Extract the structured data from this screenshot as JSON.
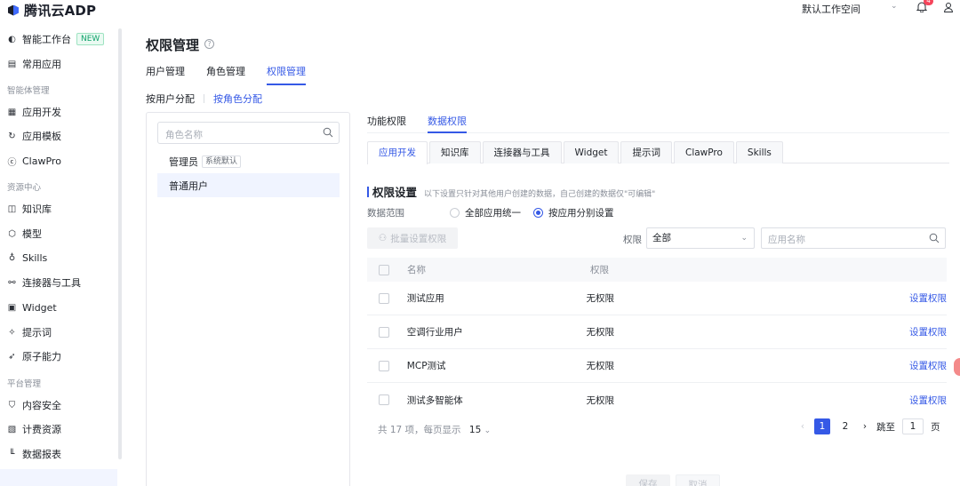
{
  "app": {
    "logo_text": "腾讯云ADP"
  },
  "header": {
    "workspace": "默认工作空间",
    "notification_count": "4"
  },
  "sidebar": {
    "items": [
      {
        "label": "智能工作台",
        "badge": "NEW",
        "icon": "workbench-icon"
      },
      {
        "label": "常用应用",
        "icon": "apps-icon"
      }
    ],
    "group_agents": "智能体管理",
    "agent_items": [
      {
        "label": "应用开发",
        "icon": "grid-icon"
      },
      {
        "label": "应用模板",
        "icon": "template-icon"
      },
      {
        "label": "ClawPro",
        "icon": "claw-icon"
      }
    ],
    "group_resources": "资源中心",
    "resource_items": [
      {
        "label": "知识库",
        "icon": "book-icon"
      },
      {
        "label": "模型",
        "icon": "cube-icon"
      },
      {
        "label": "Skills",
        "icon": "bulb-icon"
      },
      {
        "label": "连接器与工具",
        "icon": "link-icon"
      },
      {
        "label": "Widget",
        "icon": "widget-icon"
      },
      {
        "label": "提示词",
        "icon": "sparkle-icon"
      },
      {
        "label": "原子能力",
        "icon": "rocket-icon"
      }
    ],
    "group_platform": "平台管理",
    "platform_items": [
      {
        "label": "内容安全",
        "icon": "shield-icon"
      },
      {
        "label": "计费资源",
        "icon": "billing-icon"
      },
      {
        "label": "数据报表",
        "icon": "chart-icon"
      }
    ]
  },
  "page": {
    "title": "权限管理",
    "tabs": [
      "用户管理",
      "角色管理",
      "权限管理"
    ],
    "subtabs": [
      "按用户分配",
      "按角色分配"
    ]
  },
  "roles": {
    "search_placeholder": "角色名称",
    "items": [
      {
        "name": "管理员",
        "tag": "系统默认"
      },
      {
        "name": "普通用户",
        "tag": ""
      }
    ]
  },
  "permission": {
    "tabs": [
      "功能权限",
      "数据权限"
    ],
    "resource_tabs": [
      "应用开发",
      "知识库",
      "连接器与工具",
      "Widget",
      "提示词",
      "ClawPro",
      "Skills"
    ],
    "section_title": "权限设置",
    "section_desc": "以下设置只针对其他用户创建的数据，自己创建的数据仅\"可编辑\"",
    "scope_label": "数据范围",
    "scope_options": [
      "全部应用统一",
      "按应用分别设置"
    ],
    "batch_button": "批量设置权限",
    "filter_label": "权限",
    "filter_value": "全部",
    "search_placeholder": "应用名称",
    "columns": [
      "名称",
      "权限"
    ],
    "rows": [
      {
        "name": "测试应用",
        "perm": "无权限",
        "action": "设置权限"
      },
      {
        "name": "空调行业用户",
        "perm": "无权限",
        "action": "设置权限"
      },
      {
        "name": "MCP测试",
        "perm": "无权限",
        "action": "设置权限"
      },
      {
        "name": "测试多智能体",
        "perm": "无权限",
        "action": "设置权限"
      }
    ],
    "total_text": "共 17 项，每页显示",
    "page_size": "15",
    "pages": [
      "1",
      "2"
    ],
    "jump_label": "跳至",
    "jump_value": "1",
    "page_unit": "页",
    "save": "保存",
    "cancel": "取消"
  },
  "colors": {
    "accent": "#3559e6",
    "new_badge": "#11a36c"
  }
}
